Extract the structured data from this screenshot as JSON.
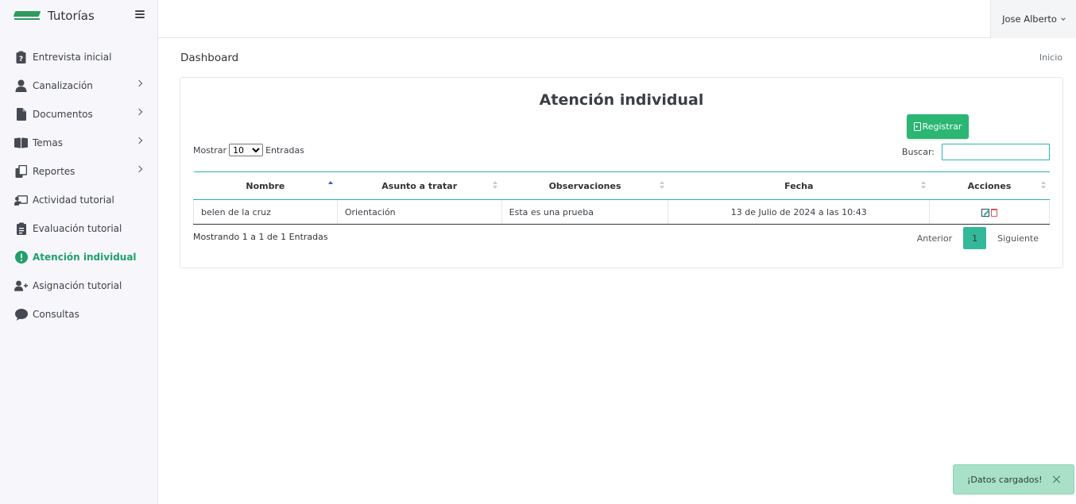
{
  "brand": {
    "title": "Tutorías"
  },
  "sidebar": {
    "items": [
      {
        "label": "Entrevista inicial",
        "icon": "clipboard-question-icon",
        "has_submenu": false
      },
      {
        "label": "Canalización",
        "icon": "user-icon",
        "has_submenu": true
      },
      {
        "label": "Documentos",
        "icon": "file-icon",
        "has_submenu": true
      },
      {
        "label": "Temas",
        "icon": "book-open-icon",
        "has_submenu": true
      },
      {
        "label": "Reportes",
        "icon": "copy-icon",
        "has_submenu": true
      },
      {
        "label": "Actividad tutorial",
        "icon": "chalkboard-teacher-icon",
        "has_submenu": false
      },
      {
        "label": "Evaluación tutorial",
        "icon": "clipboard-list-icon",
        "has_submenu": false
      },
      {
        "label": "Atención individual",
        "icon": "exclamation-circle-icon",
        "has_submenu": false,
        "active": true
      },
      {
        "label": "Asignación tutorial",
        "icon": "user-plus-icon",
        "has_submenu": false
      },
      {
        "label": "Consultas",
        "icon": "comment-icon",
        "has_submenu": false
      }
    ]
  },
  "topbar": {
    "user_name": "Jose Alberto"
  },
  "header": {
    "title": "Dashboard",
    "breadcrumb": "Inicio"
  },
  "card": {
    "title": "Atención individual",
    "register_label": "Registrar",
    "length_prefix": "Mostrar",
    "length_value": "10",
    "length_suffix": "Entradas",
    "search_label": "Buscar:",
    "search_value": ""
  },
  "table": {
    "columns": [
      "Nombre",
      "Asunto a tratar",
      "Observaciones",
      "Fecha",
      "Acciones"
    ],
    "rows": [
      {
        "nombre": "belen de la cruz",
        "asunto": "Orientación",
        "observaciones": "Esta es una prueba",
        "fecha": "13 de Julio de 2024 a las 10:43"
      }
    ]
  },
  "footer": {
    "info": "Mostrando 1 a 1 de 1 Entradas",
    "prev": "Anterior",
    "current_page": "1",
    "next": "Siguiente"
  },
  "toast": {
    "message": "¡Datos cargados!"
  },
  "colors": {
    "accent": "#2bb673",
    "active_nav": "#21a06a",
    "teal_border": "#2bb6a0",
    "toast_bg": "#a8e0c8"
  }
}
